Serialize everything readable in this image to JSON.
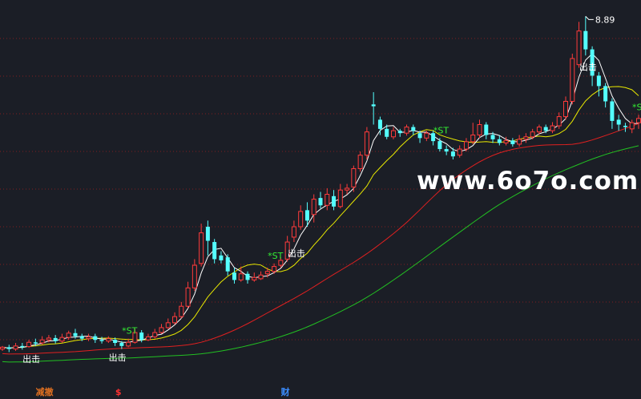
{
  "chart_data": {
    "type": "candlestick",
    "title": "",
    "high_annotation": "8.89",
    "colors": {
      "up": "#ff3b3b",
      "down": "#54ffff",
      "ma_white": "#ffffff",
      "ma_yellow": "#e8e800",
      "ma_red": "#e02020",
      "ma_green": "#22c022",
      "grid": "#9a1f1f",
      "st_label": "#33ee33",
      "exit_label": "#ffffff",
      "background": "#1b1e26"
    },
    "price_range": [
      3.0,
      9.0
    ],
    "grid": true,
    "candles": [
      [
        3.45,
        3.48,
        3.5,
        3.42
      ],
      [
        3.48,
        3.45,
        3.52,
        3.4
      ],
      [
        3.45,
        3.5,
        3.55,
        3.42
      ],
      [
        3.5,
        3.48,
        3.55,
        3.44
      ],
      [
        3.49,
        3.56,
        3.6,
        3.47
      ],
      [
        3.56,
        3.54,
        3.62,
        3.5
      ],
      [
        3.55,
        3.6,
        3.66,
        3.52
      ],
      [
        3.6,
        3.63,
        3.68,
        3.56
      ],
      [
        3.63,
        3.58,
        3.68,
        3.54
      ],
      [
        3.58,
        3.64,
        3.7,
        3.55
      ],
      [
        3.64,
        3.71,
        3.75,
        3.6
      ],
      [
        3.71,
        3.66,
        3.78,
        3.62
      ],
      [
        3.66,
        3.62,
        3.7,
        3.58
      ],
      [
        3.62,
        3.65,
        3.7,
        3.58
      ],
      [
        3.66,
        3.6,
        3.7,
        3.55
      ],
      [
        3.6,
        3.58,
        3.65,
        3.54
      ],
      [
        3.58,
        3.62,
        3.66,
        3.55
      ],
      [
        3.6,
        3.55,
        3.64,
        3.5
      ],
      [
        3.55,
        3.5,
        3.58,
        3.45
      ],
      [
        3.5,
        3.56,
        3.62,
        3.48
      ],
      [
        3.56,
        3.72,
        3.78,
        3.54
      ],
      [
        3.72,
        3.6,
        3.76,
        3.56
      ],
      [
        3.6,
        3.65,
        3.7,
        3.58
      ],
      [
        3.65,
        3.72,
        3.78,
        3.62
      ],
      [
        3.72,
        3.8,
        3.86,
        3.7
      ],
      [
        3.8,
        3.88,
        3.95,
        3.78
      ],
      [
        3.88,
        3.98,
        4.05,
        3.85
      ],
      [
        3.98,
        4.15,
        4.22,
        3.95
      ],
      [
        4.15,
        4.45,
        4.55,
        4.12
      ],
      [
        4.45,
        4.82,
        4.92,
        4.4
      ],
      [
        4.85,
        5.35,
        5.5,
        4.8
      ],
      [
        5.45,
        5.22,
        5.55,
        4.98
      ],
      [
        5.2,
        4.92,
        5.25,
        4.85
      ],
      [
        4.98,
        4.9,
        5.05,
        4.85
      ],
      [
        4.95,
        4.72,
        5.0,
        4.65
      ],
      [
        4.7,
        4.58,
        4.78,
        4.52
      ],
      [
        4.58,
        4.68,
        4.8,
        4.55
      ],
      [
        4.68,
        4.58,
        4.72,
        4.52
      ],
      [
        4.58,
        4.62,
        4.7,
        4.55
      ],
      [
        4.6,
        4.66,
        4.72,
        4.58
      ],
      [
        4.68,
        4.72,
        4.78,
        4.62
      ],
      [
        4.72,
        4.8,
        4.85,
        4.68
      ],
      [
        4.82,
        4.9,
        4.95,
        4.78
      ],
      [
        4.92,
        5.2,
        5.3,
        4.88
      ],
      [
        5.28,
        5.45,
        5.55,
        5.2
      ],
      [
        5.45,
        5.7,
        5.8,
        5.4
      ],
      [
        5.72,
        5.55,
        5.85,
        5.45
      ],
      [
        5.65,
        5.9,
        5.98,
        5.52
      ],
      [
        5.92,
        5.8,
        6.02,
        5.75
      ],
      [
        5.8,
        5.98,
        6.08,
        5.72
      ],
      [
        5.95,
        5.78,
        6.05,
        5.72
      ],
      [
        5.78,
        6.05,
        6.15,
        5.75
      ],
      [
        6.05,
        6.08,
        6.15,
        5.98
      ],
      [
        6.1,
        6.4,
        6.45,
        6.02
      ],
      [
        6.4,
        6.62,
        6.68,
        6.35
      ],
      [
        6.62,
        7.0,
        7.08,
        6.55
      ],
      [
        7.45,
        7.42,
        7.65,
        7.12
      ],
      [
        7.2,
        7.05,
        7.25,
        6.95
      ],
      [
        7.05,
        6.92,
        7.12,
        6.88
      ],
      [
        6.92,
        7.02,
        7.08,
        6.88
      ],
      [
        7.02,
        6.98,
        7.05,
        6.92
      ],
      [
        6.98,
        7.08,
        7.12,
        6.94
      ],
      [
        7.08,
        7.02,
        7.12,
        6.95
      ],
      [
        6.98,
        6.9,
        7.02,
        6.82
      ],
      [
        6.9,
        6.98,
        7.02,
        6.85
      ],
      [
        6.98,
        6.85,
        7.02,
        6.78
      ],
      [
        6.85,
        6.72,
        6.9,
        6.68
      ],
      [
        6.72,
        6.68,
        6.78,
        6.62
      ],
      [
        6.68,
        6.6,
        6.74,
        6.55
      ],
      [
        6.62,
        6.72,
        6.78,
        6.58
      ],
      [
        6.72,
        6.84,
        6.9,
        6.68
      ],
      [
        6.84,
        6.95,
        7.15,
        6.8
      ],
      [
        6.95,
        7.12,
        7.2,
        6.9
      ],
      [
        7.12,
        6.95,
        7.16,
        6.88
      ],
      [
        6.95,
        6.88,
        7.0,
        6.82
      ],
      [
        6.88,
        6.82,
        6.94,
        6.78
      ],
      [
        6.82,
        6.86,
        6.92,
        6.78
      ],
      [
        6.86,
        6.8,
        6.9,
        6.76
      ],
      [
        6.8,
        6.88,
        6.95,
        6.76
      ],
      [
        6.88,
        6.92,
        6.98,
        6.82
      ],
      [
        6.92,
        7.0,
        7.05,
        6.88
      ],
      [
        7.0,
        7.08,
        7.12,
        6.96
      ],
      [
        7.08,
        7.02,
        7.12,
        6.98
      ],
      [
        7.02,
        7.1,
        7.16,
        6.98
      ],
      [
        7.1,
        7.25,
        7.32,
        7.05
      ],
      [
        7.25,
        7.5,
        7.58,
        7.2
      ],
      [
        7.5,
        8.2,
        8.28,
        7.45
      ],
      [
        8.1,
        8.65,
        8.8,
        8.05
      ],
      [
        8.65,
        8.35,
        8.89,
        8.25
      ],
      [
        8.35,
        7.92,
        8.4,
        7.75
      ],
      [
        7.92,
        7.75,
        7.98,
        7.58
      ],
      [
        7.75,
        7.5,
        7.8,
        7.4
      ],
      [
        7.5,
        7.18,
        7.55,
        7.05
      ],
      [
        7.2,
        7.12,
        7.28,
        7.02
      ],
      [
        7.1,
        7.08,
        7.15,
        7.0
      ],
      [
        7.05,
        7.15,
        7.2,
        6.98
      ],
      [
        7.15,
        7.22,
        7.28,
        7.05
      ]
    ],
    "events": [
      {
        "index": 4,
        "type": "exit",
        "label": "出击"
      },
      {
        "index": 17,
        "type": "exit",
        "label": "出击"
      },
      {
        "index": 19,
        "type": "st",
        "label": "*ST"
      },
      {
        "index": 41,
        "type": "st",
        "label": "*ST"
      },
      {
        "index": 44,
        "type": "exit",
        "label": "出击"
      },
      {
        "index": 66,
        "type": "st",
        "label": "*ST"
      },
      {
        "index": 88,
        "type": "exit",
        "label": "出击"
      },
      {
        "index": 96,
        "type": "st",
        "label": "*ST"
      }
    ],
    "bottom_markers": [
      {
        "index": 6,
        "label": "减撤",
        "color": "#e07020"
      },
      {
        "index": 18,
        "label": "$",
        "color": "#ff3030"
      },
      {
        "index": 43,
        "label": "财",
        "color": "#3b8dff"
      }
    ]
  },
  "watermark": "www.6o7o.com"
}
